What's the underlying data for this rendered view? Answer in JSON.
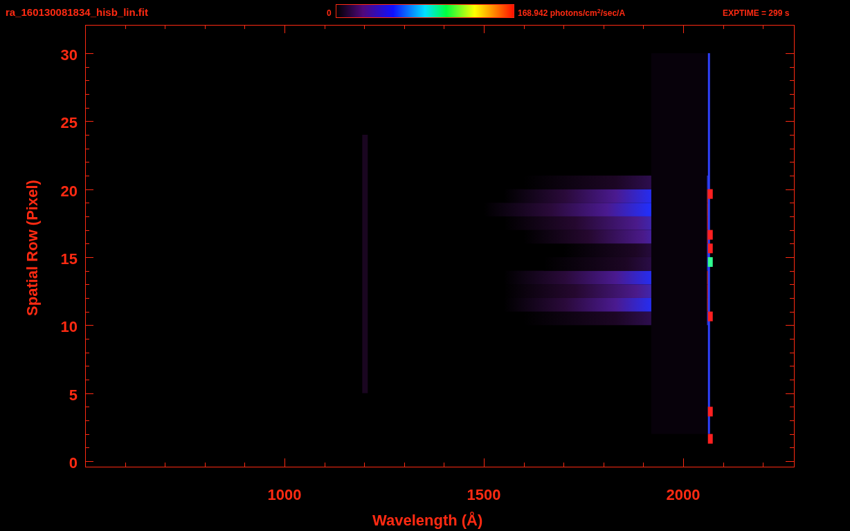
{
  "header": {
    "file_name": "ra_160130081834_hisb_lin.fit",
    "colorbar_min": "0",
    "colorbar_max": "168.942 photons/cm$^{2}$/sec/A",
    "exposure": "EXPTIME = 299 s"
  },
  "plot": {
    "ylabel": "Spatial Row (Pixel)",
    "xlabel": "Wavelength (Å)",
    "yticks": [
      "30",
      "25",
      "20",
      "15",
      "10",
      "5",
      "0"
    ],
    "xticks": [
      "1000",
      "1500",
      "2000"
    ]
  }
}
